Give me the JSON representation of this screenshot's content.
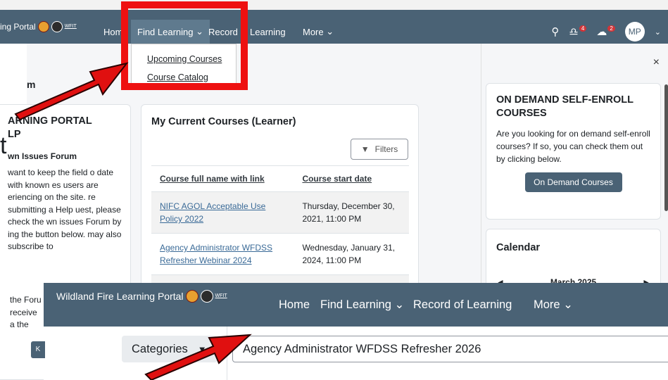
{
  "topbar": {
    "brand": "ing Portal",
    "logo_text": "WFIT",
    "nav": {
      "home": "Hom",
      "find_learning": "Find Learning",
      "record": "Record",
      "learning": "Learning",
      "more": "More"
    },
    "notifications_count": "4",
    "messages_count": "2",
    "avatar_initials": "MP"
  },
  "dropdown": {
    "items": [
      "Upcoming Courses",
      "Course Catalog"
    ]
  },
  "drawer": {
    "close": "×",
    "on_demand": {
      "title": "ON DEMAND SELF-ENROLL COURSES",
      "text": "Are you looking for on demand self-enroll courses? If so, you can check them out by clicking below.",
      "button": "On Demand Courses"
    },
    "calendar": {
      "title": "Calendar",
      "month": "March 2025",
      "prev": "◄",
      "next": "►"
    }
  },
  "help": {
    "title": "ARNING PORTAL\nLP",
    "subtitle": "wn Issues Forum",
    "text": "want to keep the field o date with known es users are eriencing on the site. re submitting a Help uest, please check the wn issues Forum by ing the button below. may also subscribe to",
    "extra": "the Foru receive a the Foru",
    "button": "K",
    "bg_letter": "t",
    "bg_frag": "m"
  },
  "courses": {
    "title": "My Current Courses (Learner)",
    "filters": "Filters",
    "headers": [
      "Course full name with link",
      "Course start date"
    ],
    "rows": [
      {
        "name": "NIFC AGOL Acceptable Use Policy 2022",
        "date": "Thursday, December 30, 2021, 11:00 PM"
      },
      {
        "name": "Agency Administrator WFDSS Refresher Webinar 2024",
        "date": "Wednesday, January 31, 2024, 11:00 PM"
      }
    ]
  },
  "overlay": {
    "brand": "Wildland Fire Learning Portal",
    "logo_text": "WFIT",
    "nav": {
      "home": "Home",
      "find_learning": "Find Learning",
      "record": "Record of Learning",
      "more": "More"
    },
    "categories": "Categories",
    "search_value": "Agency Administrator WFDSS Refresher 2026"
  },
  "colors": {
    "brand_bar": "#4a6275",
    "highlight": "#ee1111",
    "link": "#3a6a97",
    "badge": "#d13438"
  }
}
